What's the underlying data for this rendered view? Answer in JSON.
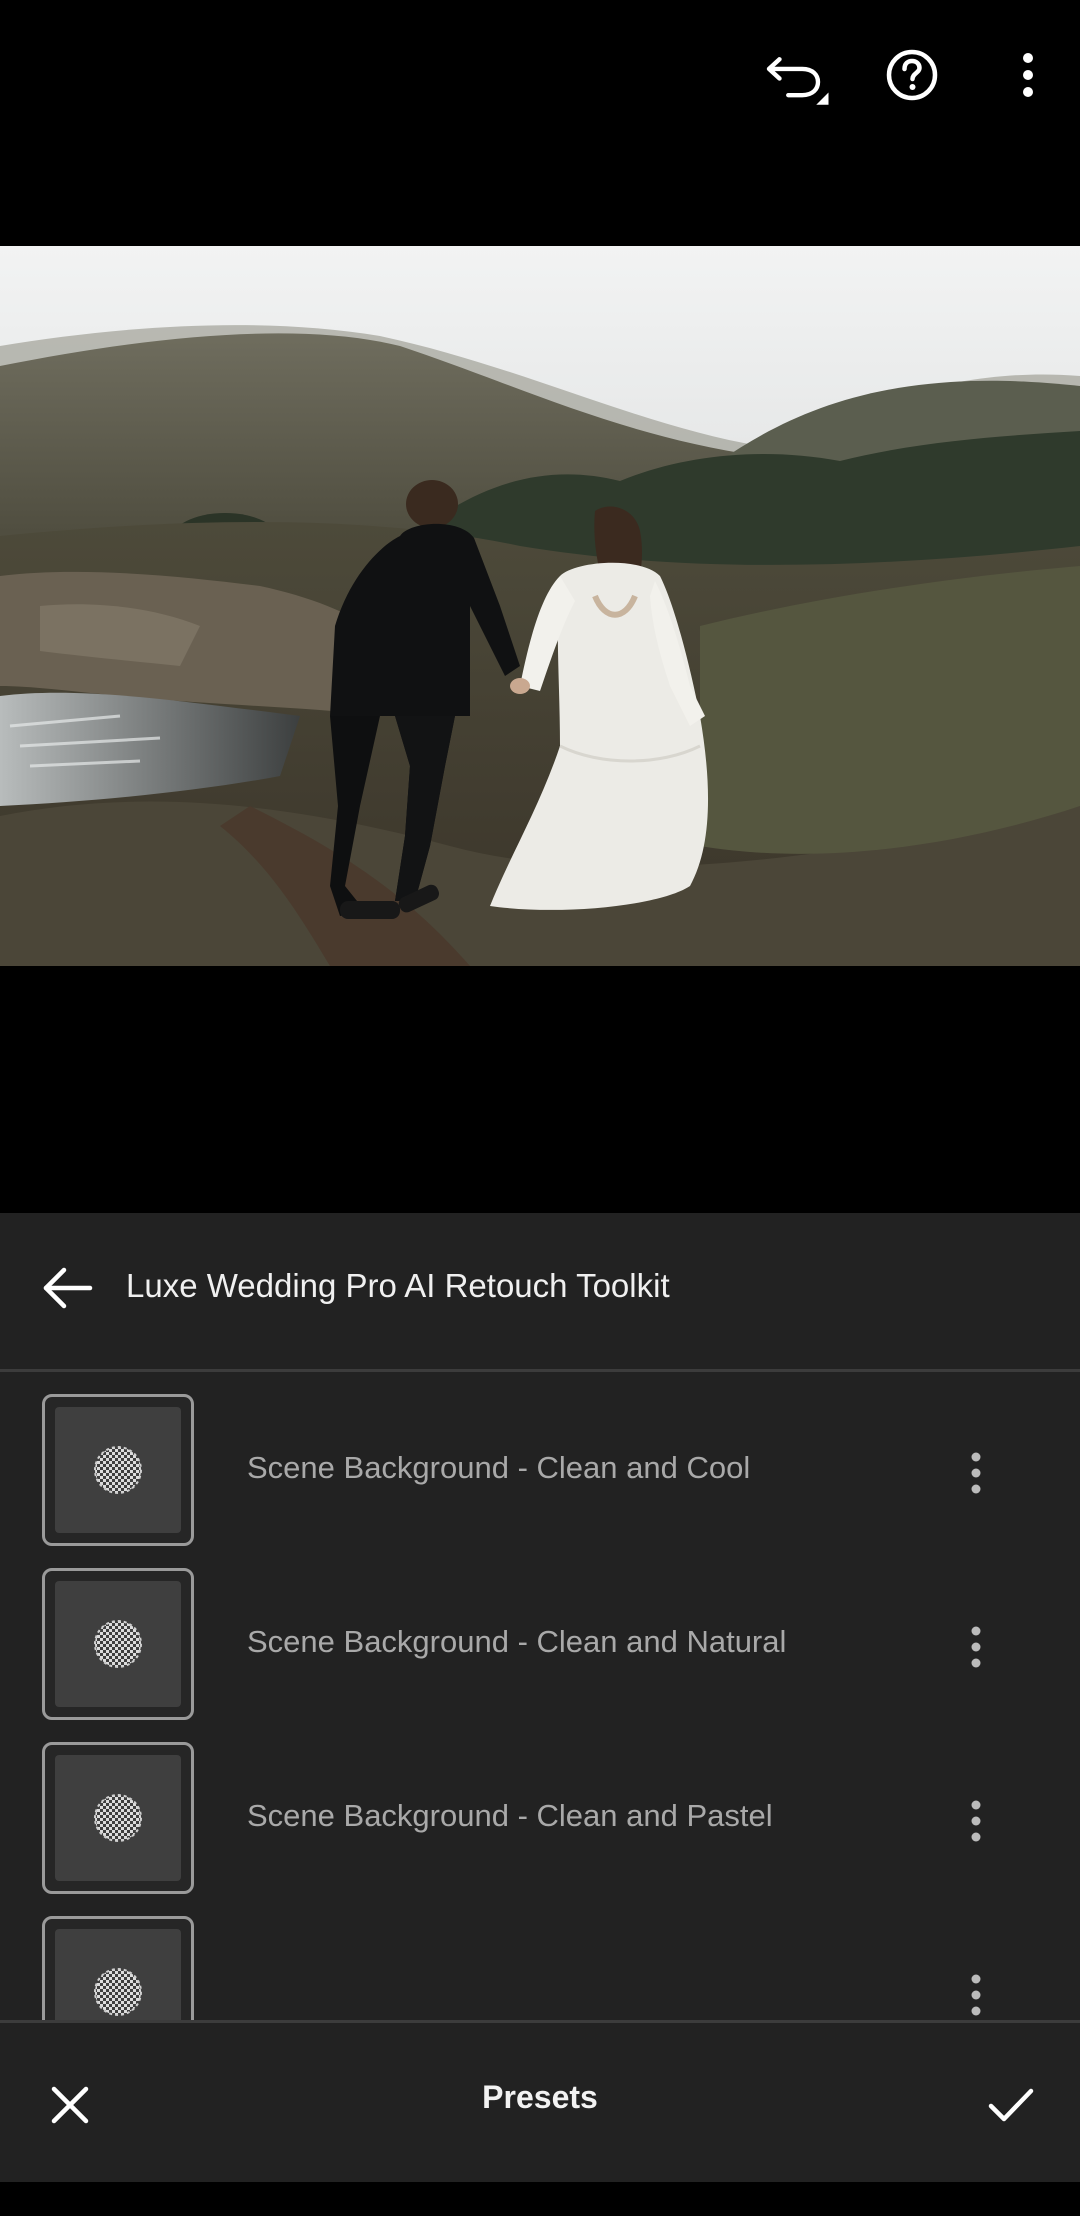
{
  "toolbar": {
    "undo_icon": "undo-icon",
    "help_icon": "help-icon",
    "more_icon": "more-vertical-icon"
  },
  "photo": {
    "description_icon": "photo-canvas"
  },
  "panel": {
    "back_icon": "arrow-left-icon",
    "title": "Luxe Wedding Pro AI Retouch Toolkit",
    "presets": [
      {
        "label": "Scene Background - Clean and Cool"
      },
      {
        "label": "Scene Background - Clean and Natural"
      },
      {
        "label": "Scene Background - Clean and Pastel"
      },
      {
        "label": ""
      }
    ]
  },
  "bottom_bar": {
    "cancel_icon": "close-icon",
    "title": "Presets",
    "confirm_icon": "checkmark-icon"
  },
  "colors": {
    "panel_bg": "#222222",
    "divider": "#3c3c3c",
    "label_text": "#a9a9a9"
  }
}
